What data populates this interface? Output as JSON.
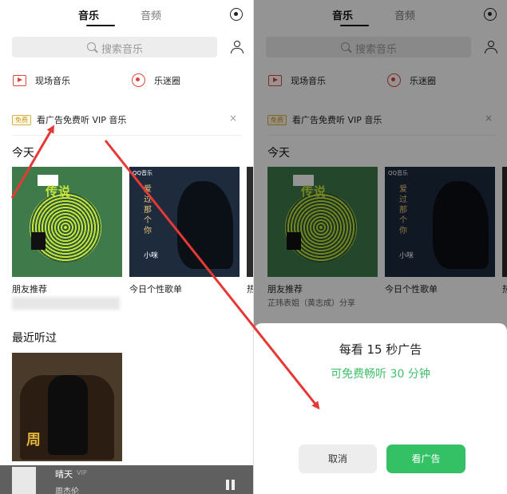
{
  "tabs": {
    "music": "音乐",
    "audio": "音频"
  },
  "search": {
    "placeholder": "搜索音乐"
  },
  "quick_links": [
    {
      "label": "现场音乐"
    },
    {
      "label": "乐迷圈"
    }
  ],
  "ad_banner": {
    "badge": "免费",
    "text": "看广告免费听 VIP 音乐",
    "close": "×"
  },
  "today": {
    "title": "今天",
    "cards": [
      {
        "label": "朋友推荐",
        "subtitle": "芷玮表姐（黄志成）分享",
        "cover_text": "传说"
      },
      {
        "label": "今日个性歌单",
        "cover_logo": "QQ音乐",
        "cover_vertical": "爱过那个你",
        "cover_artist": "小咪"
      },
      {
        "label": "热"
      }
    ]
  },
  "recent": {
    "title": "最近听过",
    "cover_text": "周"
  },
  "player": {
    "title": "晴天",
    "badge": "VIP",
    "artist": "周杰伦"
  },
  "dialog": {
    "title": "每看 15 秒广告",
    "subtitle": "可免费畅听 30 分钟",
    "cancel": "取消",
    "confirm": "看广告"
  },
  "colors": {
    "accent_red": "#e0453a",
    "confirm_green": "#34c065",
    "subtitle_green": "#3fbf6a",
    "ad_badge": "#c89a1e"
  }
}
